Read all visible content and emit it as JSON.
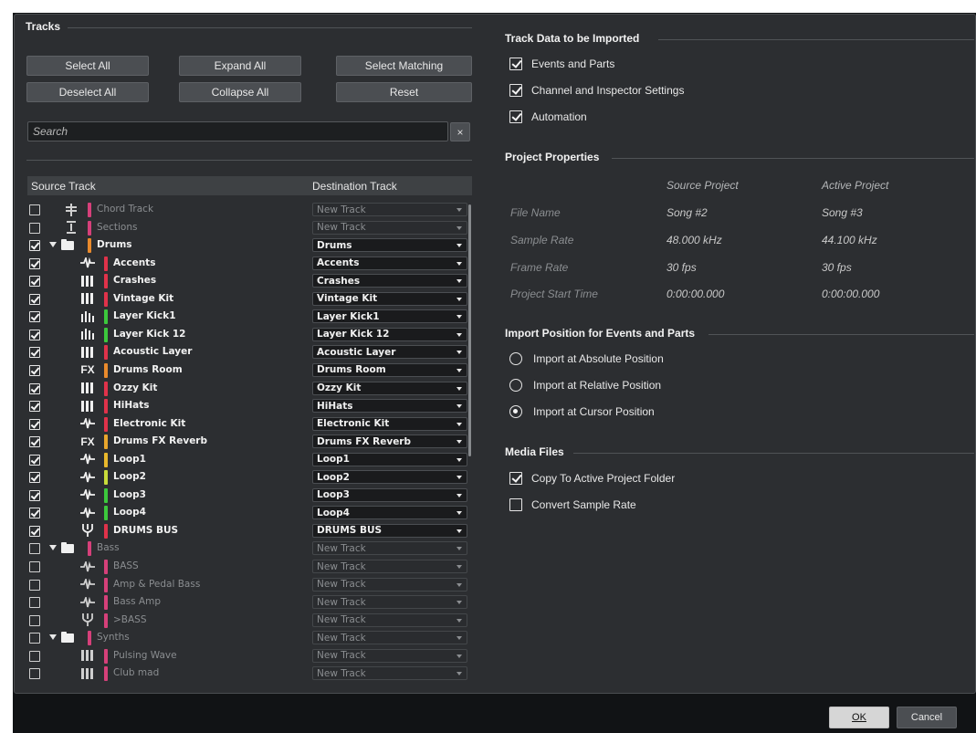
{
  "tracks": {
    "title": "Tracks",
    "buttons": {
      "select_all": "Select All",
      "expand_all": "Expand All",
      "select_matching": "Select Matching",
      "deselect_all": "Deselect All",
      "collapse_all": "Collapse All",
      "reset": "Reset"
    },
    "search_placeholder": "Search",
    "clear_label": "×",
    "columns": {
      "source": "Source Track",
      "destination": "Destination Track"
    },
    "rows": [
      {
        "checked": false,
        "dim": true,
        "indent": 0,
        "folder": false,
        "icon": "chord-icon",
        "color": "#d6407a",
        "name": "Chord Track",
        "dest": "New Track"
      },
      {
        "checked": false,
        "dim": true,
        "indent": 0,
        "folder": false,
        "icon": "sections-icon",
        "color": "#d6407a",
        "name": "Sections",
        "dest": "New Track"
      },
      {
        "checked": true,
        "dim": false,
        "indent": 0,
        "folder": true,
        "icon": "folder-icon",
        "color": "#e98a2c",
        "name": "Drums",
        "dest": "Drums"
      },
      {
        "checked": true,
        "dim": false,
        "indent": 1,
        "folder": false,
        "icon": "audio-icon",
        "color": "#e0324a",
        "name": "Accents",
        "dest": "Accents"
      },
      {
        "checked": true,
        "dim": false,
        "indent": 1,
        "folder": false,
        "icon": "instrument-icon",
        "color": "#e0324a",
        "name": "Crashes",
        "dest": "Crashes"
      },
      {
        "checked": true,
        "dim": false,
        "indent": 1,
        "folder": false,
        "icon": "instrument-icon",
        "color": "#e0324a",
        "name": "Vintage Kit",
        "dest": "Vintage Kit"
      },
      {
        "checked": true,
        "dim": false,
        "indent": 1,
        "folder": false,
        "icon": "midi-icon",
        "color": "#3cc83c",
        "name": "Layer Kick1",
        "dest": "Layer Kick1"
      },
      {
        "checked": true,
        "dim": false,
        "indent": 1,
        "folder": false,
        "icon": "midi-icon",
        "color": "#3cc83c",
        "name": "Layer Kick 12",
        "dest": "Layer Kick 12"
      },
      {
        "checked": true,
        "dim": false,
        "indent": 1,
        "folder": false,
        "icon": "instrument-icon",
        "color": "#e0324a",
        "name": "Acoustic Layer",
        "dest": "Acoustic Layer"
      },
      {
        "checked": true,
        "dim": false,
        "indent": 1,
        "folder": false,
        "icon": "fx-icon",
        "color": "#e98a2c",
        "name": "Drums Room",
        "dest": "Drums Room"
      },
      {
        "checked": true,
        "dim": false,
        "indent": 1,
        "folder": false,
        "icon": "instrument-icon",
        "color": "#e0324a",
        "name": "Ozzy Kit",
        "dest": "Ozzy Kit"
      },
      {
        "checked": true,
        "dim": false,
        "indent": 1,
        "folder": false,
        "icon": "instrument-icon",
        "color": "#e0324a",
        "name": "HiHats",
        "dest": "HiHats"
      },
      {
        "checked": true,
        "dim": false,
        "indent": 1,
        "folder": false,
        "icon": "audio-icon",
        "color": "#e0324a",
        "name": "Electronic Kit",
        "dest": "Electronic Kit"
      },
      {
        "checked": true,
        "dim": false,
        "indent": 1,
        "folder": false,
        "icon": "fx-icon",
        "color": "#e9a62c",
        "name": "Drums FX Reverb",
        "dest": "Drums FX Reverb"
      },
      {
        "checked": true,
        "dim": false,
        "indent": 1,
        "folder": false,
        "icon": "audio-icon",
        "color": "#e9b82c",
        "name": "Loop1",
        "dest": "Loop1"
      },
      {
        "checked": true,
        "dim": false,
        "indent": 1,
        "folder": false,
        "icon": "audio-icon",
        "color": "#c8dc3a",
        "name": "Loop2",
        "dest": "Loop2"
      },
      {
        "checked": true,
        "dim": false,
        "indent": 1,
        "folder": false,
        "icon": "audio-icon",
        "color": "#3cc83c",
        "name": "Loop3",
        "dest": "Loop3"
      },
      {
        "checked": true,
        "dim": false,
        "indent": 1,
        "folder": false,
        "icon": "audio-icon",
        "color": "#3cc83c",
        "name": "Loop4",
        "dest": "Loop4"
      },
      {
        "checked": true,
        "dim": false,
        "indent": 1,
        "folder": false,
        "icon": "group-icon",
        "color": "#e0324a",
        "name": "DRUMS BUS",
        "dest": "DRUMS BUS"
      },
      {
        "checked": false,
        "dim": true,
        "indent": 0,
        "folder": true,
        "icon": "folder-icon",
        "color": "#d6407a",
        "name": "Bass",
        "dest": "New Track"
      },
      {
        "checked": false,
        "dim": true,
        "indent": 1,
        "folder": false,
        "icon": "audio-icon",
        "color": "#d6407a",
        "name": "BASS",
        "dest": "New Track"
      },
      {
        "checked": false,
        "dim": true,
        "indent": 1,
        "folder": false,
        "icon": "audio-icon",
        "color": "#d6407a",
        "name": "Amp & Pedal Bass",
        "dest": "New Track"
      },
      {
        "checked": false,
        "dim": true,
        "indent": 1,
        "folder": false,
        "icon": "audio-icon",
        "color": "#d6407a",
        "name": "Bass Amp",
        "dest": "New Track"
      },
      {
        "checked": false,
        "dim": true,
        "indent": 1,
        "folder": false,
        "icon": "group-icon",
        "color": "#d6407a",
        "name": ">BASS",
        "dest": "New Track"
      },
      {
        "checked": false,
        "dim": true,
        "indent": 0,
        "folder": true,
        "icon": "folder-icon",
        "color": "#d6407a",
        "name": "Synths",
        "dest": "New Track"
      },
      {
        "checked": false,
        "dim": true,
        "indent": 1,
        "folder": false,
        "icon": "instrument-icon",
        "color": "#d6407a",
        "name": "Pulsing Wave",
        "dest": "New Track"
      },
      {
        "checked": false,
        "dim": true,
        "indent": 1,
        "folder": false,
        "icon": "instrument-icon",
        "color": "#d6407a",
        "name": "Club mad",
        "dest": "New Track"
      }
    ]
  },
  "track_data": {
    "title": "Track Data to be Imported",
    "options": [
      {
        "label": "Events and Parts",
        "checked": true
      },
      {
        "label": "Channel and Inspector Settings",
        "checked": true
      },
      {
        "label": "Automation",
        "checked": true
      }
    ]
  },
  "project_properties": {
    "title": "Project Properties",
    "col_source": "Source Project",
    "col_active": "Active Project",
    "rows": [
      {
        "label": "File Name",
        "source": "Song #2",
        "active": "Song #3"
      },
      {
        "label": "Sample Rate",
        "source": "48.000 kHz",
        "active": "44.100 kHz"
      },
      {
        "label": "Frame Rate",
        "source": "30 fps",
        "active": "30 fps"
      },
      {
        "label": "Project Start Time",
        "source": "0:00:00.000",
        "active": "0:00:00.000"
      }
    ]
  },
  "import_position": {
    "title": "Import Position for Events and Parts",
    "options": [
      {
        "label": "Import at Absolute Position",
        "selected": false
      },
      {
        "label": "Import at Relative Position",
        "selected": false
      },
      {
        "label": "Import at Cursor Position",
        "selected": true
      }
    ]
  },
  "media_files": {
    "title": "Media Files",
    "options": [
      {
        "label": "Copy To Active Project Folder",
        "checked": true
      },
      {
        "label": "Convert Sample Rate",
        "checked": false
      }
    ]
  },
  "footer": {
    "ok": "OK",
    "cancel": "Cancel"
  }
}
